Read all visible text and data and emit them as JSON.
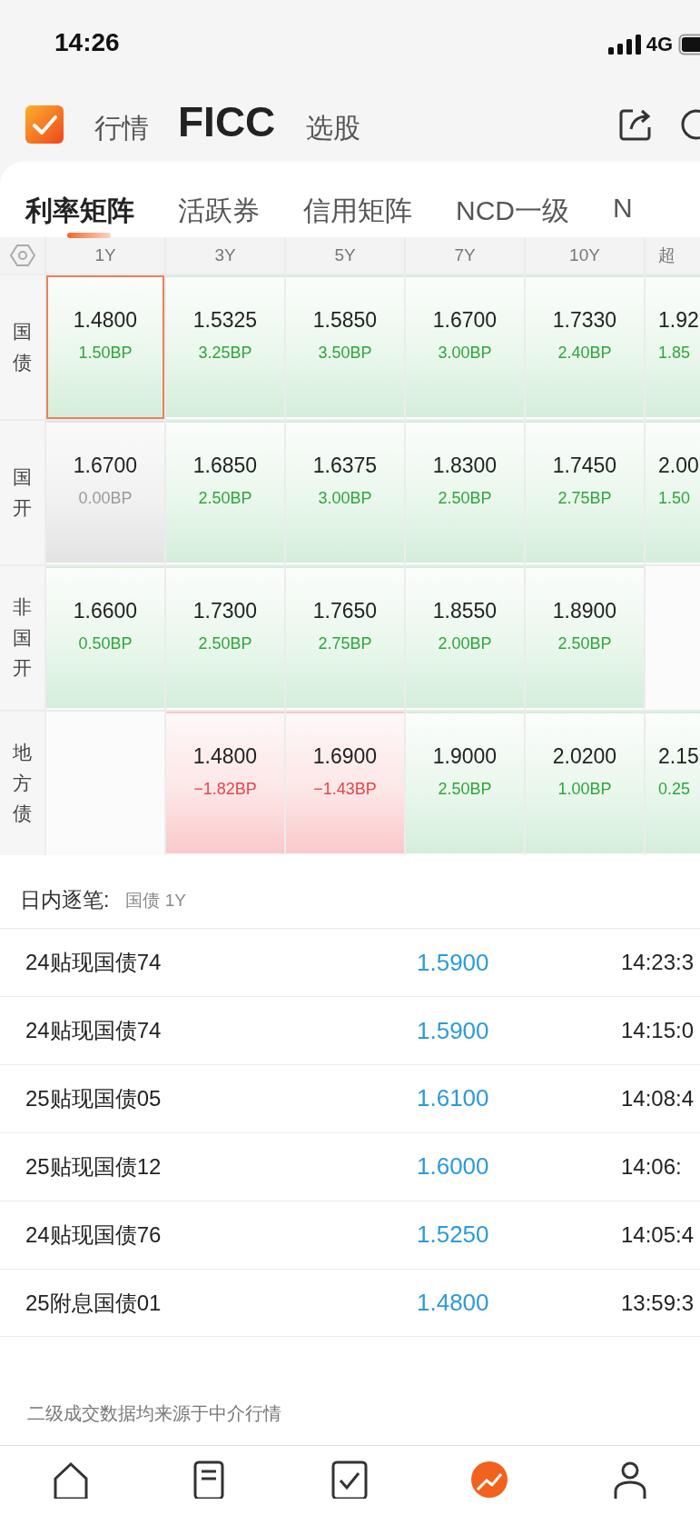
{
  "status_bar": {
    "time": "14:26",
    "network": "4G"
  },
  "header": {
    "tabs": [
      {
        "label": "行情",
        "selected": false
      },
      {
        "label": "FICC",
        "selected": true
      },
      {
        "label": "选股",
        "selected": false
      }
    ]
  },
  "categories": [
    {
      "label": "利率矩阵",
      "selected": true
    },
    {
      "label": "活跃券",
      "selected": false
    },
    {
      "label": "信用矩阵",
      "selected": false
    },
    {
      "label": "NCD一级",
      "selected": false
    },
    {
      "label": "N",
      "selected": false
    }
  ],
  "matrix": {
    "columns": [
      "1Y",
      "3Y",
      "5Y",
      "7Y",
      "10Y",
      "超"
    ],
    "rows": [
      {
        "label": "国债",
        "cells": [
          {
            "kind": "up",
            "value": "1.4800",
            "change": "1.50BP",
            "selected": true
          },
          {
            "kind": "up",
            "value": "1.5325",
            "change": "3.25BP",
            "selected": false
          },
          {
            "kind": "up",
            "value": "1.5850",
            "change": "3.50BP",
            "selected": false
          },
          {
            "kind": "up",
            "value": "1.6700",
            "change": "3.00BP",
            "selected": false
          },
          {
            "kind": "up",
            "value": "1.7330",
            "change": "2.40BP",
            "selected": false
          },
          {
            "kind": "up",
            "value": "1.92",
            "change": "1.85",
            "selected": false
          }
        ]
      },
      {
        "label": "国开",
        "cells": [
          {
            "kind": "flat",
            "value": "1.6700",
            "change": "0.00BP",
            "selected": false
          },
          {
            "kind": "up",
            "value": "1.6850",
            "change": "2.50BP",
            "selected": false
          },
          {
            "kind": "up",
            "value": "1.6375",
            "change": "3.00BP",
            "selected": false
          },
          {
            "kind": "up",
            "value": "1.8300",
            "change": "2.50BP",
            "selected": false
          },
          {
            "kind": "up",
            "value": "1.7450",
            "change": "2.75BP",
            "selected": false
          },
          {
            "kind": "up",
            "value": "2.00",
            "change": "1.50",
            "selected": false
          }
        ]
      },
      {
        "label": "非国开",
        "cells": [
          {
            "kind": "up",
            "value": "1.6600",
            "change": "0.50BP",
            "selected": false
          },
          {
            "kind": "up",
            "value": "1.7300",
            "change": "2.50BP",
            "selected": false
          },
          {
            "kind": "up",
            "value": "1.7650",
            "change": "2.75BP",
            "selected": false
          },
          {
            "kind": "up",
            "value": "1.8550",
            "change": "2.00BP",
            "selected": false
          },
          {
            "kind": "up",
            "value": "1.8900",
            "change": "2.50BP",
            "selected": false
          },
          {
            "kind": "empty",
            "selected": false
          }
        ]
      },
      {
        "label": "地方债",
        "cells": [
          {
            "kind": "empty",
            "selected": false
          },
          {
            "kind": "down",
            "value": "1.4800",
            "change": "−1.82BP",
            "selected": false
          },
          {
            "kind": "down",
            "value": "1.6900",
            "change": "−1.43BP",
            "selected": false
          },
          {
            "kind": "up",
            "value": "1.9000",
            "change": "2.50BP",
            "selected": false
          },
          {
            "kind": "up",
            "value": "2.0200",
            "change": "1.00BP",
            "selected": false
          },
          {
            "kind": "up",
            "value": "2.15",
            "change": "0.25",
            "selected": false
          }
        ]
      }
    ]
  },
  "intraday": {
    "title": "日内逐笔:",
    "subject": "国债 1Y",
    "rows": [
      {
        "name": "24贴现国债74",
        "rate": "1.5900",
        "time": "14:23:3"
      },
      {
        "name": "24贴现国债74",
        "rate": "1.5900",
        "time": "14:15:0"
      },
      {
        "name": "25贴现国债05",
        "rate": "1.6100",
        "time": "14:08:4"
      },
      {
        "name": "25贴现国债12",
        "rate": "1.6000",
        "time": "14:06:"
      },
      {
        "name": "24贴现国债76",
        "rate": "1.5250",
        "time": "14:05:4"
      },
      {
        "name": "25附息国债01",
        "rate": "1.4800",
        "time": "13:59:3"
      }
    ]
  },
  "footnote": "二级成交数据均来源于中介行情",
  "bottom_nav": [
    {
      "selected": false
    },
    {
      "selected": false
    },
    {
      "selected": false
    },
    {
      "selected": true
    },
    {
      "selected": false
    }
  ]
}
